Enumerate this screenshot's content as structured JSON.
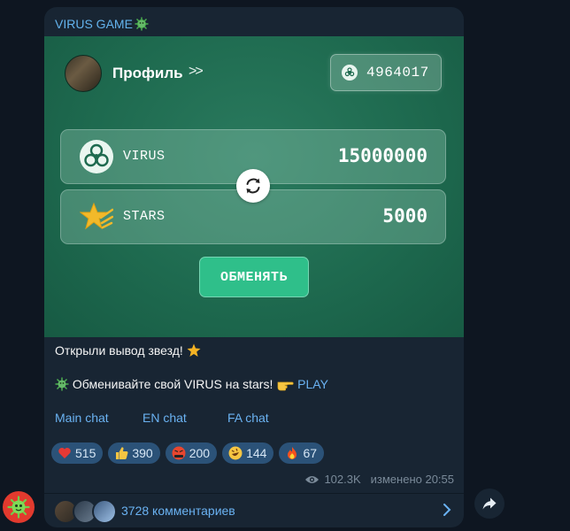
{
  "post": {
    "channel_name": "VIRUS GAME",
    "game": {
      "profile_label": "Профиль",
      "profile_arrows": ">>",
      "balance": "4964017",
      "virus_label": "VIRUS",
      "virus_value": "15000000",
      "stars_label": "STARS",
      "stars_value": "5000",
      "exchange_button": "ОБМЕНЯТЬ"
    },
    "text_line1": "Открыли вывод звезд!",
    "text_line2": "Обменивайте свой VIRUS на stars!",
    "play_link": "PLAY",
    "chat_links": [
      "Main chat",
      "EN chat",
      "FA chat"
    ],
    "reactions": [
      {
        "emoji": "red-heart",
        "count": "515"
      },
      {
        "emoji": "thumbs-up",
        "count": "390"
      },
      {
        "emoji": "angry-face",
        "count": "200"
      },
      {
        "emoji": "rofl-face",
        "count": "144"
      },
      {
        "emoji": "fire",
        "count": "67"
      }
    ],
    "views": "102.3K",
    "edited_label": "изменено 20:55",
    "comments_label": "3728 комментариев"
  },
  "colors": {
    "background": "#0e1621",
    "bubble": "#182533",
    "banner": "#1e6a4f",
    "link": "#6ab2f2",
    "exchange_button": "#2fbf8a"
  }
}
